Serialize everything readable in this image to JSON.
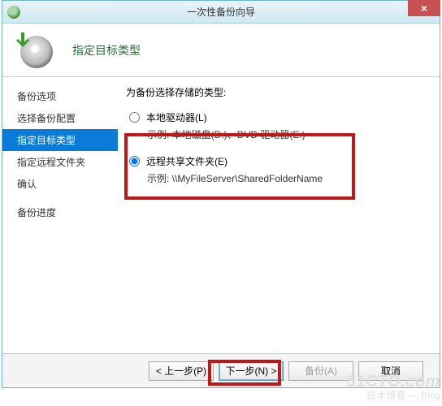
{
  "window": {
    "title": "一次性备份向导",
    "close_label": "×"
  },
  "page_title": "指定目标类型",
  "sidebar": {
    "items": [
      "备份选项",
      "选择备份配置",
      "指定目标类型",
      "指定远程文件夹",
      "确认",
      "备份进度"
    ],
    "selected_index": 2
  },
  "content": {
    "prompt": "为备份选择存储的类型:",
    "option1": {
      "label": "本地驱动器(L)",
      "example": "示例: 本地磁盘(D:)、DVD 驱动器(E:)",
      "checked": false
    },
    "option2": {
      "label": "远程共享文件夹(E)",
      "example": "示例: \\\\MyFileServer\\SharedFolderName",
      "checked": true
    }
  },
  "footer": {
    "prev": "< 上一步(P)",
    "next": "下一步(N) >",
    "backup": "备份(A)",
    "cancel": "取消"
  },
  "watermark": {
    "line1": "51CTO.com",
    "line2": "技术博客 — Blog"
  }
}
